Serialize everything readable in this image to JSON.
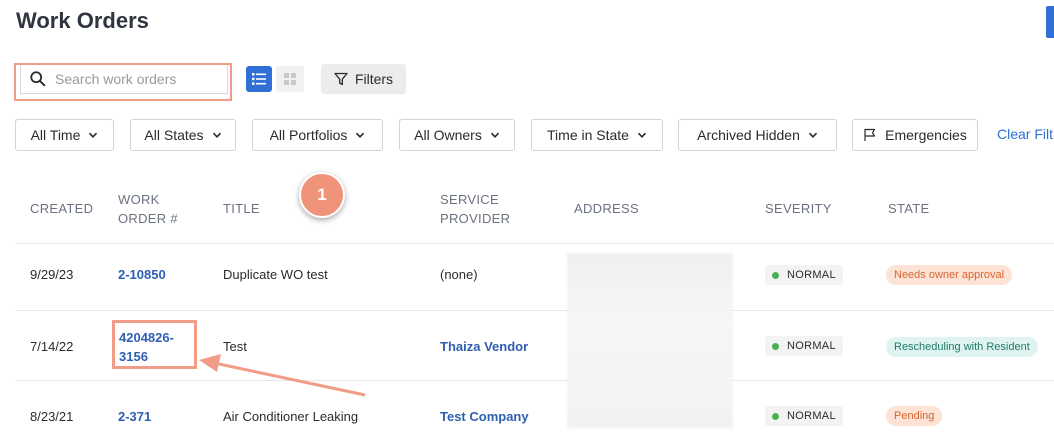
{
  "page": {
    "title": "Work Orders"
  },
  "search": {
    "placeholder": "Search work orders",
    "value": ""
  },
  "toolbar": {
    "filters_label": "Filters"
  },
  "filters": {
    "time": "All Time",
    "states": "All States",
    "portfolios": "All Portfolios",
    "owners": "All Owners",
    "time_in_state": "Time in State",
    "archived": "Archived Hidden",
    "emergencies": "Emergencies",
    "clear": "Clear Filt"
  },
  "table": {
    "headers": {
      "created": "CREATED",
      "work_order_1": "WORK",
      "work_order_2": "ORDER #",
      "title": "TITLE",
      "service_provider_1": "SERVICE",
      "service_provider_2": "PROVIDER",
      "address": "ADDRESS",
      "severity": "SEVERITY",
      "state": "STATE"
    },
    "rows": [
      {
        "created": "9/29/23",
        "work_order": "2-10850",
        "title": "Duplicate WO test",
        "service_provider": "(none)",
        "severity": "NORMAL",
        "state": "Needs owner approval"
      },
      {
        "created": "7/14/22",
        "work_order_1": "4204826-",
        "work_order_2": "3156",
        "title": "Test",
        "service_provider": "Thaiza Vendor",
        "severity": "NORMAL",
        "state": "Rescheduling with Resident"
      },
      {
        "created": "8/23/21",
        "work_order": "2-371",
        "title": "Air Conditioner Leaking",
        "service_provider": "Test Company",
        "severity": "NORMAL",
        "state": "Pending"
      }
    ]
  },
  "annotation": {
    "step_number": "1"
  },
  "colors": {
    "accent": "#2f6fd6",
    "highlight": "#f29b86",
    "normal_dot": "#4caf50",
    "state_orange_bg": "#fde3d6",
    "state_orange_text": "#d9652f",
    "state_teal_bg": "#dff4f0",
    "state_teal_text": "#1f7a6a"
  }
}
